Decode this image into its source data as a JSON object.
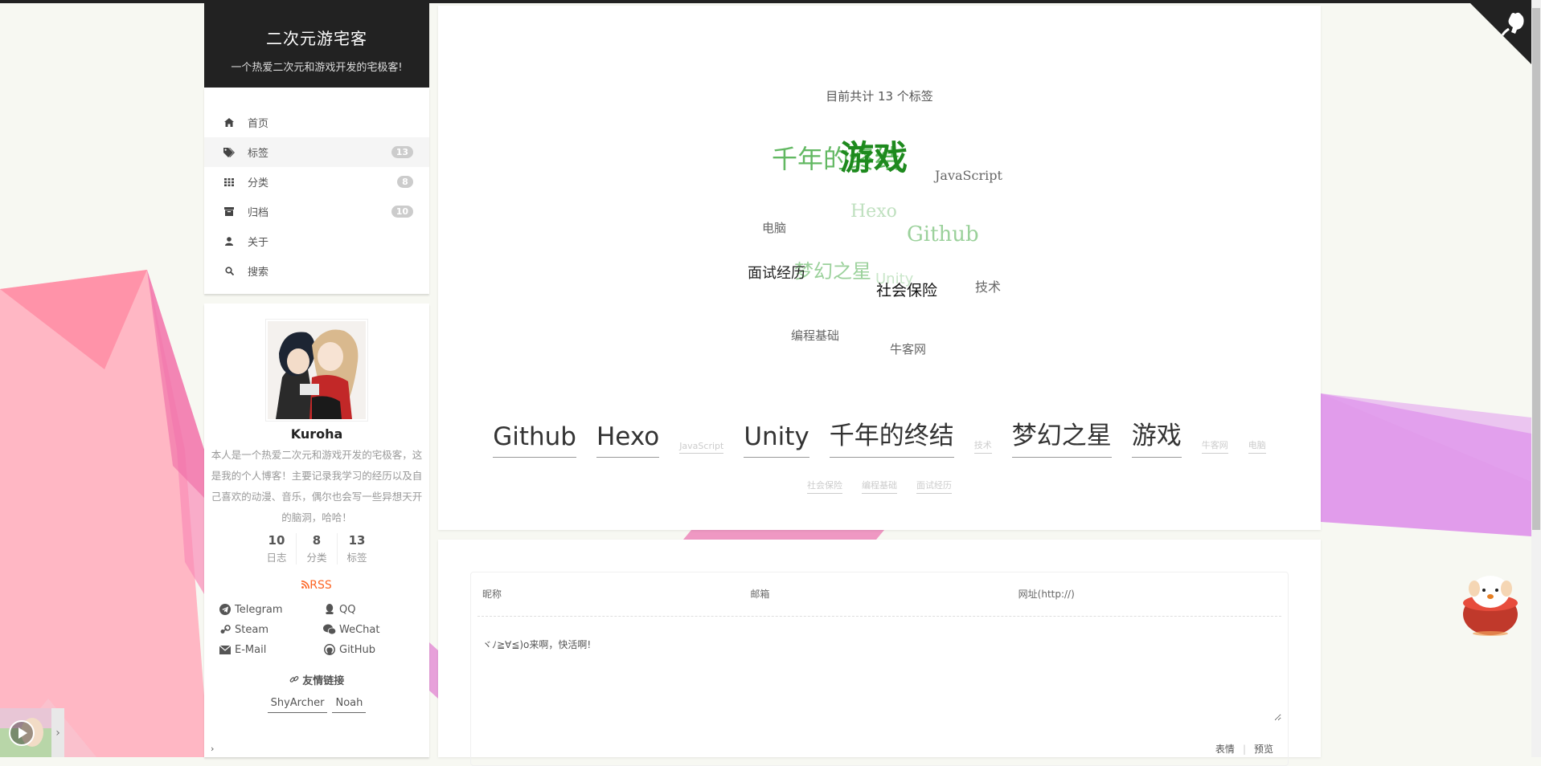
{
  "site": {
    "title": "二次元游宅客",
    "subtitle": "一个热爱二次元和游戏开发的宅极客!"
  },
  "menu": {
    "items": [
      {
        "label": "首页",
        "icon": "home-icon",
        "badge": ""
      },
      {
        "label": "标签",
        "icon": "tags-icon",
        "badge": "13"
      },
      {
        "label": "分类",
        "icon": "th-icon",
        "badge": "8"
      },
      {
        "label": "归档",
        "icon": "archive-icon",
        "badge": "10"
      },
      {
        "label": "关于",
        "icon": "user-icon",
        "badge": ""
      },
      {
        "label": "搜索",
        "icon": "search-icon",
        "badge": ""
      }
    ],
    "active_index": 1
  },
  "profile": {
    "author": "Kuroha",
    "description": "本人是一个热爱二次元和游戏开发的宅极客，这是我的个人博客！主要记录我学习的经历以及自己喜欢的动漫、音乐，偶尔也会写一些异想天开的脑洞，哈哈！",
    "stats": [
      {
        "num": "10",
        "label": "日志"
      },
      {
        "num": "8",
        "label": "分类"
      },
      {
        "num": "13",
        "label": "标签"
      }
    ],
    "rss": "RSS",
    "social": [
      {
        "label": "Telegram",
        "icon": "telegram-icon"
      },
      {
        "label": "QQ",
        "icon": "qq-icon"
      },
      {
        "label": "Steam",
        "icon": "steam-icon"
      },
      {
        "label": "WeChat",
        "icon": "wechat-icon"
      },
      {
        "label": "E-Mail",
        "icon": "envelope-icon"
      },
      {
        "label": "GitHub",
        "icon": "github-icon"
      }
    ],
    "friends_title": "友情链接",
    "friends": [
      "ShyArcher",
      "Noah"
    ],
    "caret": "›"
  },
  "tags_page": {
    "count_text": "目前共计 13 个标签",
    "cloud": [
      {
        "text": "千年的终结",
        "color": "#62b862"
      },
      {
        "text": "游戏",
        "color": "#1e8a1e"
      },
      {
        "text": "JavaScript",
        "color": "#666666"
      },
      {
        "text": "Hexo",
        "color": "#bfe0bf"
      },
      {
        "text": "电脑",
        "color": "#666666"
      },
      {
        "text": "Github",
        "color": "#9bd19b"
      },
      {
        "text": "梦幻之星",
        "color": "#9bd19b"
      },
      {
        "text": "Unity",
        "color": "#c9e6c9"
      },
      {
        "text": "面试经历",
        "color": "#222222"
      },
      {
        "text": "社会保险",
        "color": "#111111"
      },
      {
        "text": "技术",
        "color": "#666666"
      },
      {
        "text": "编程基础",
        "color": "#666666"
      },
      {
        "text": "牛客网",
        "color": "#666666"
      }
    ],
    "list_row1": [
      {
        "text": "Github",
        "size": "big"
      },
      {
        "text": "Hexo",
        "size": "big"
      },
      {
        "text": "JavaScript",
        "size": "small"
      },
      {
        "text": "Unity",
        "size": "big"
      },
      {
        "text": "千年的终结",
        "size": "big"
      },
      {
        "text": "技术",
        "size": "small"
      },
      {
        "text": "梦幻之星",
        "size": "big"
      },
      {
        "text": "游戏",
        "size": "big"
      },
      {
        "text": "牛客网",
        "size": "small"
      },
      {
        "text": "电脑",
        "size": "small"
      }
    ],
    "list_row2": [
      {
        "text": "社会保险",
        "size": "small"
      },
      {
        "text": "编程基础",
        "size": "small"
      },
      {
        "text": "面试经历",
        "size": "small"
      }
    ]
  },
  "comments": {
    "nick_placeholder": "昵称",
    "mail_placeholder": "邮箱",
    "link_placeholder": "网址(http://)",
    "text_placeholder": "ヾﾉ≧∀≦)o来啊，快活啊!",
    "emoji_label": "表情",
    "preview_label": "预览"
  }
}
